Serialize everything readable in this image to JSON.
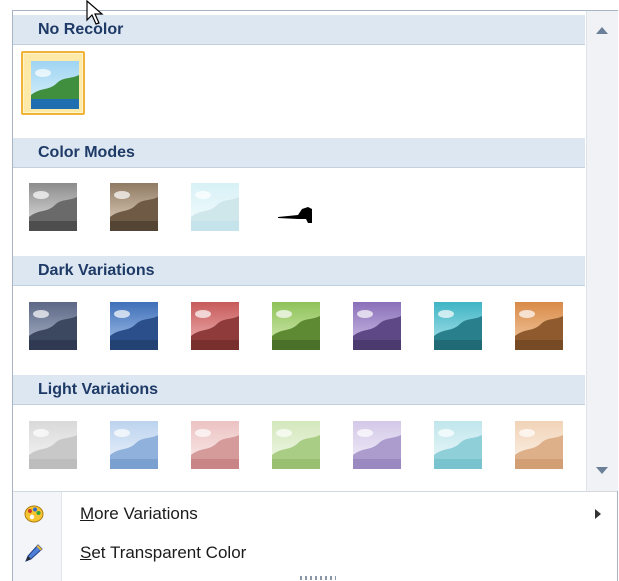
{
  "sections": [
    {
      "title": "No Recolor",
      "count": 1,
      "selected": 0,
      "tints": [
        "original"
      ]
    },
    {
      "title": "Color Modes",
      "count": 4,
      "tints": [
        "grayscale",
        "sepia",
        "washout",
        "black-and-white"
      ]
    },
    {
      "title": "Dark Variations",
      "count": 7,
      "tints": [
        "dark-blue-gray",
        "dark-blue",
        "dark-red",
        "dark-green",
        "dark-purple",
        "dark-aqua",
        "dark-orange"
      ]
    },
    {
      "title": "Light Variations",
      "count": 7,
      "tints": [
        "light-gray",
        "light-blue",
        "light-red",
        "light-green",
        "light-purple",
        "light-aqua",
        "light-orange"
      ]
    }
  ],
  "menu": {
    "more_variations": {
      "label": "More Variations",
      "accelerator": "M",
      "icon": "palette-icon",
      "has_submenu": true
    },
    "set_transparent": {
      "label": "Set Transparent Color",
      "accelerator": "S",
      "icon": "pencil-eyedropper-icon"
    }
  },
  "colors": {
    "header_bg": "#dde7f1",
    "header_text": "#1e3a66",
    "selected_border": "#f2b33a",
    "selected_fill": "#fde9a8"
  }
}
